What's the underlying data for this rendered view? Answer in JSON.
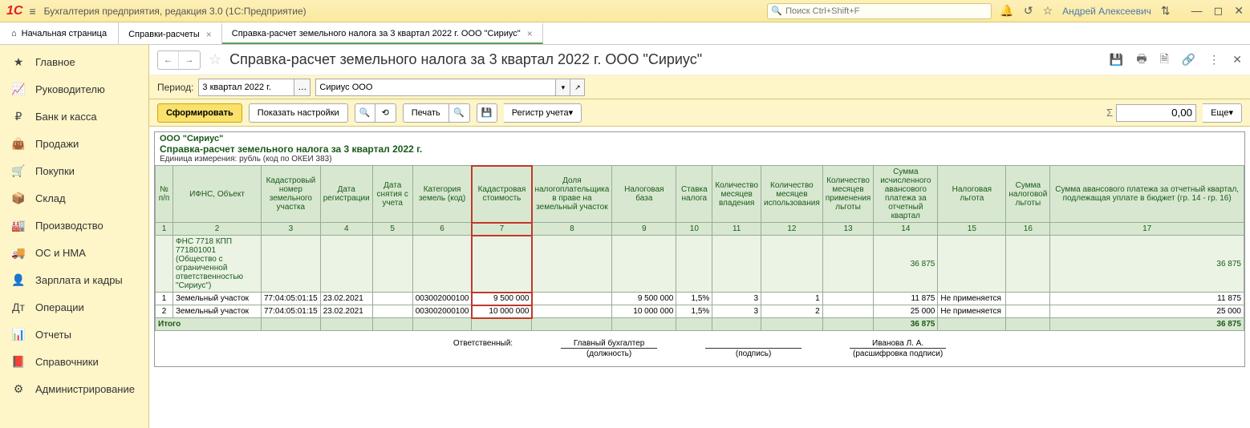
{
  "app": {
    "title": "Бухгалтерия предприятия, редакция 3.0  (1С:Предприятие)",
    "search_placeholder": "Поиск Ctrl+Shift+F",
    "user": "Андрей Алексеевич"
  },
  "tabs": {
    "home": "Начальная страница",
    "items": [
      {
        "label": "Справки-расчеты"
      },
      {
        "label": "Справка-расчет земельного налога за 3 квартал 2022 г. ООО \"Сириус\""
      }
    ]
  },
  "sidebar": {
    "items": [
      {
        "label": "Главное"
      },
      {
        "label": "Руководителю"
      },
      {
        "label": "Банк и касса"
      },
      {
        "label": "Продажи"
      },
      {
        "label": "Покупки"
      },
      {
        "label": "Склад"
      },
      {
        "label": "Производство"
      },
      {
        "label": "ОС и НМА"
      },
      {
        "label": "Зарплата и кадры"
      },
      {
        "label": "Операции"
      },
      {
        "label": "Отчеты"
      },
      {
        "label": "Справочники"
      },
      {
        "label": "Администрирование"
      }
    ]
  },
  "content": {
    "title": "Справка-расчет земельного налога за 3 квартал 2022 г. ООО \"Сириус\"",
    "period_label": "Период:",
    "period_value": "3 квартал 2022 г.",
    "org_value": "Сириус ООО",
    "btn_form": "Сформировать",
    "btn_settings": "Показать настройки",
    "btn_print": "Печать",
    "btn_register": "Регистр учета",
    "btn_more": "Еще",
    "sum_value": "0,00"
  },
  "report": {
    "org": "ООО \"Сириус\"",
    "title": "Справка-расчет земельного налога за 3 квартал 2022 г.",
    "unit": "Единица измерения: рубль (код по ОКЕИ 383)",
    "columns": [
      "№ п/п",
      "ИФНС, Объект",
      "Кадастровый номер земельного участка",
      "Дата регистрации",
      "Дата снятия с учета",
      "Категория земель (код)",
      "Кадастровая стоимость",
      "Доля налогоплательщика в праве на земельный участок",
      "Налоговая база",
      "Ставка налога",
      "Количество месяцев владения",
      "Количество месяцев использования",
      "Количество месяцев применения льготы",
      "Сумма исчисленного авансового платежа за отчетный квартал",
      "Налоговая льгота",
      "Сумма налоговой льготы",
      "Сумма авансового платежа за отчетный квартал, подлежащая уплате в бюджет (гр. 14 - гр. 16)"
    ],
    "group": {
      "name": "ФНС 7718 КПП 771801001 (Общество с ограниченной ответственностью \"Сириус\")",
      "sum14": "36 875",
      "sum17": "36 875"
    },
    "rows": [
      {
        "n": "1",
        "obj": "Земельный участок",
        "cad": "77:04:05:01:15",
        "reg": "23.02.2021",
        "off": "",
        "cat": "003002000100",
        "cost": "9 500 000",
        "share": "",
        "base": "9 500 000",
        "rate": "1,5%",
        "mown": "3",
        "muse": "1",
        "mlg": "",
        "s14": "11 875",
        "lg": "Не применяется",
        "slg": "",
        "s17": "11 875"
      },
      {
        "n": "2",
        "obj": "Земельный участок",
        "cad": "77:04:05:01:15",
        "reg": "23.02.2021",
        "off": "",
        "cat": "003002000100",
        "cost": "10 000 000",
        "share": "",
        "base": "10 000 000",
        "rate": "1,5%",
        "mown": "3",
        "muse": "2",
        "mlg": "",
        "s14": "25 000",
        "lg": "Не применяется",
        "slg": "",
        "s17": "25 000"
      }
    ],
    "total": {
      "label": "Итого",
      "s14": "36 875",
      "s17": "36 875"
    },
    "sign": {
      "label": "Ответственный:",
      "pos_val": "Главный бухгалтер",
      "pos_lbl": "(должность)",
      "sig_lbl": "(подпись)",
      "name_val": "Иванова Л. А.",
      "name_lbl": "(расшифровка подписи)"
    }
  }
}
